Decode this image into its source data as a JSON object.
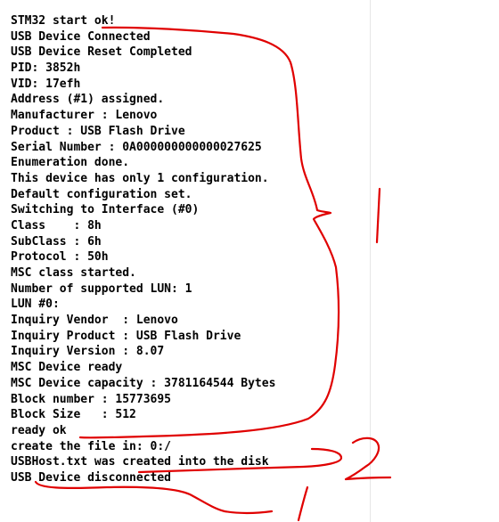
{
  "terminal": {
    "lines": [
      "STM32 start ok!",
      "USB Device Connected",
      "USB Device Reset Completed",
      "PID: 3852h",
      "VID: 17efh",
      "Address (#1) assigned.",
      "Manufacturer : Lenovo",
      "Product : USB Flash Drive",
      "Serial Number : 0A000000000000027625",
      "Enumeration done.",
      "This device has only 1 configuration.",
      "Default configuration set.",
      "Switching to Interface (#0)",
      "Class    : 8h",
      "SubClass : 6h",
      "Protocol : 50h",
      "MSC class started.",
      "Number of supported LUN: 1",
      "LUN #0:",
      "Inquiry Vendor  : Lenovo",
      "Inquiry Product : USB Flash Drive",
      "Inquiry Version : 8.07",
      "MSC Device ready",
      "MSC Device capacity : 3781164544 Bytes",
      "Block number : 15773695",
      "Block Size   : 512",
      "ready ok",
      "create the file in: 0:/",
      "USBHost.txt was created into the disk",
      "USB Device disconnected"
    ]
  },
  "annotations": {
    "ink_color": "#e00000",
    "marks": [
      "bracket-loop-1",
      "vertical-stroke-1",
      "numeral-2",
      "underline-created",
      "underline-disconnected",
      "vertical-stroke-bottom"
    ]
  }
}
